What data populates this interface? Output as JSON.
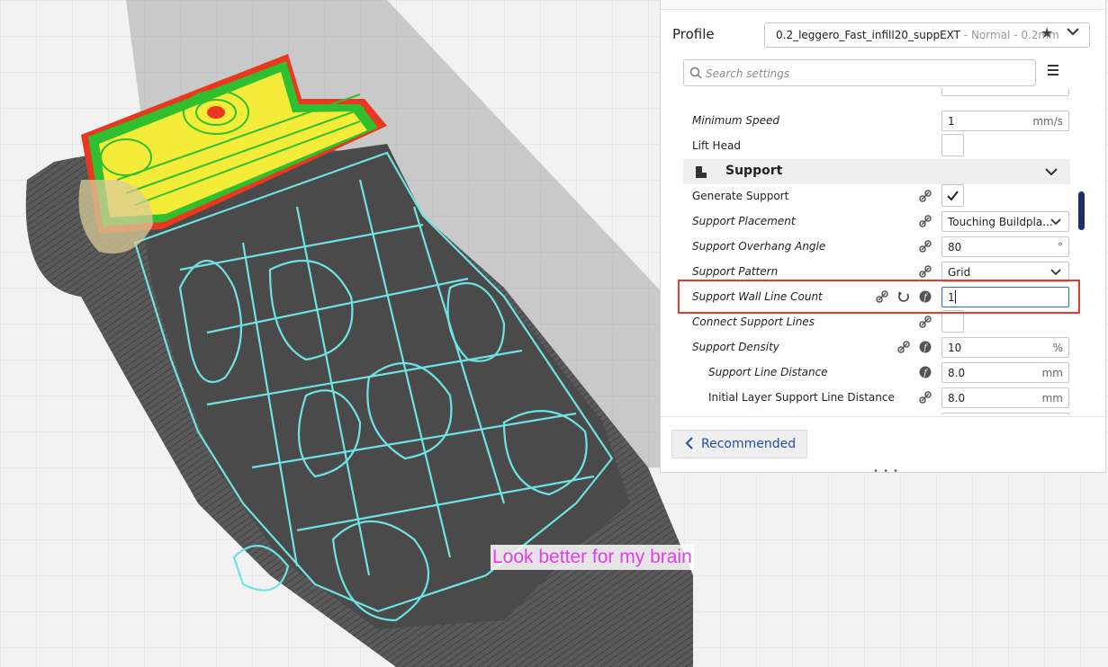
{
  "annotation": {
    "text": "Look better for my brain",
    "color": "#e23fe8"
  },
  "panel": {
    "profile_label": "Profile",
    "profile_value": "0.2_leggero_Fast_infill20_suppEXT",
    "profile_sub": " - Normal - 0.2mm",
    "search_placeholder": "Search settings",
    "settings": [
      {
        "label": "Minimum Speed",
        "value": "1",
        "unit": "mm/s"
      },
      {
        "label": "Lift Head",
        "value": ""
      },
      {
        "category": "Support"
      },
      {
        "label": "Generate Support",
        "checked": true
      },
      {
        "label": "Support Placement",
        "value": "Touching Buildpla..."
      },
      {
        "label": "Support Overhang Angle",
        "value": "80",
        "unit": "°"
      },
      {
        "label": "Support Pattern",
        "value": "Grid"
      },
      {
        "label": "Support Wall Line Count",
        "value": "1"
      },
      {
        "label": "Connect Support Lines",
        "value": ""
      },
      {
        "label": "Support Density",
        "value": "10",
        "unit": "%"
      },
      {
        "label": "Support Line Distance",
        "value": "8.0",
        "unit": "mm"
      },
      {
        "label": "Initial Layer Support Line Distance",
        "value": "8.0",
        "unit": "mm"
      }
    ],
    "recommended_label": "Recommended",
    "grip": "• • •"
  },
  "colors": {
    "accent": "#1d6fe5",
    "highlight_box": "#e0402a",
    "support_lines": "#6fe3e3",
    "infill": "#f5ec3a",
    "walls": "#2fbf2f",
    "outer_wall": "#e8381f"
  }
}
